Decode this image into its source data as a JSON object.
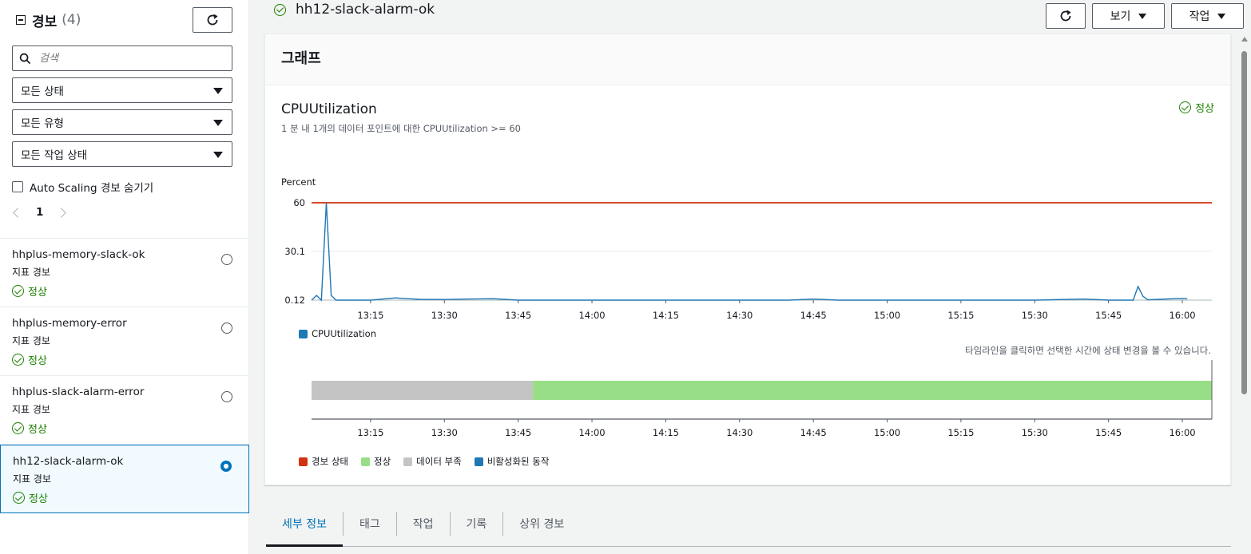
{
  "sidebar": {
    "title": "경보",
    "count": "(4)",
    "search_placeholder": "검색",
    "filters": [
      {
        "label": "모든 상태"
      },
      {
        "label": "모든 유형"
      },
      {
        "label": "모든 작업 상태"
      }
    ],
    "hide_autoscaling_label": "Auto Scaling 경보 숨기기",
    "page": "1",
    "alarms": [
      {
        "name": "hhplus-memory-slack-ok",
        "type": "지표 경보",
        "status": "정상",
        "selected": false
      },
      {
        "name": "hhplus-memory-error",
        "type": "지표 경보",
        "status": "정상",
        "selected": false
      },
      {
        "name": "hhplus-slack-alarm-error",
        "type": "지표 경보",
        "status": "정상",
        "selected": false
      },
      {
        "name": "hh12-slack-alarm-ok",
        "type": "지표 경보",
        "status": "정상",
        "selected": true
      }
    ]
  },
  "header": {
    "title": "hh12-slack-alarm-ok",
    "view_label": "보기",
    "action_label": "작업"
  },
  "graph": {
    "panel_title": "그래프",
    "metric_title": "CPUUtilization",
    "subtitle": "1 분 내 1개의 데이터 포인트에 대한 CPUUtilization >= 60",
    "status": "정상",
    "timeline_hint": "타임라인을 클릭하면 선택한 시간에 상태 변경을 볼 수 있습니다.",
    "timeline_legend": [
      {
        "label": "경보 상태",
        "color": "#d13212"
      },
      {
        "label": "정상",
        "color": "#98de87"
      },
      {
        "label": "데이터 부족",
        "color": "#c4c4c4"
      },
      {
        "label": "비활성화된 동작",
        "color": "#1f77b4"
      }
    ]
  },
  "chart_data": {
    "type": "line",
    "ylabel": "Percent",
    "yticks": [
      "60",
      "30.1",
      "0.12"
    ],
    "ylim": [
      0.12,
      60
    ],
    "threshold": 60,
    "threshold_color": "#d13212",
    "x_ticks": [
      "13:15",
      "13:30",
      "13:45",
      "14:00",
      "14:15",
      "14:30",
      "14:45",
      "15:00",
      "15:15",
      "15:30",
      "15:45",
      "16:00"
    ],
    "series": [
      {
        "name": "CPUUtilization",
        "color": "#1f77b4",
        "x": [
          "13:03",
          "13:04",
          "13:05",
          "13:06",
          "13:07",
          "13:08",
          "13:10",
          "13:15",
          "13:20",
          "13:25",
          "13:30",
          "13:35",
          "13:40",
          "13:45",
          "13:50",
          "14:00",
          "14:15",
          "14:30",
          "14:40",
          "14:45",
          "14:50",
          "15:00",
          "15:15",
          "15:30",
          "15:40",
          "15:45",
          "15:50",
          "15:51",
          "15:52",
          "15:53",
          "15:55",
          "16:00",
          "16:01"
        ],
        "y": [
          0.12,
          3,
          0.12,
          60,
          3,
          0.12,
          0.12,
          0.12,
          1.5,
          0.6,
          0.5,
          0.8,
          1.0,
          0.12,
          0.12,
          0.12,
          0.12,
          0.12,
          0.12,
          0.8,
          0.12,
          0.12,
          0.12,
          0.12,
          0.8,
          0.12,
          0.12,
          8.5,
          2.5,
          0.3,
          0.6,
          1.2,
          1.0
        ]
      }
    ],
    "timeline": {
      "segments": [
        {
          "state": "데이터 부족",
          "start": "13:03",
          "end": "13:48",
          "color": "#c4c4c4"
        },
        {
          "state": "정상",
          "start": "13:48",
          "end": "16:06",
          "color": "#98de87"
        }
      ]
    }
  }
}
